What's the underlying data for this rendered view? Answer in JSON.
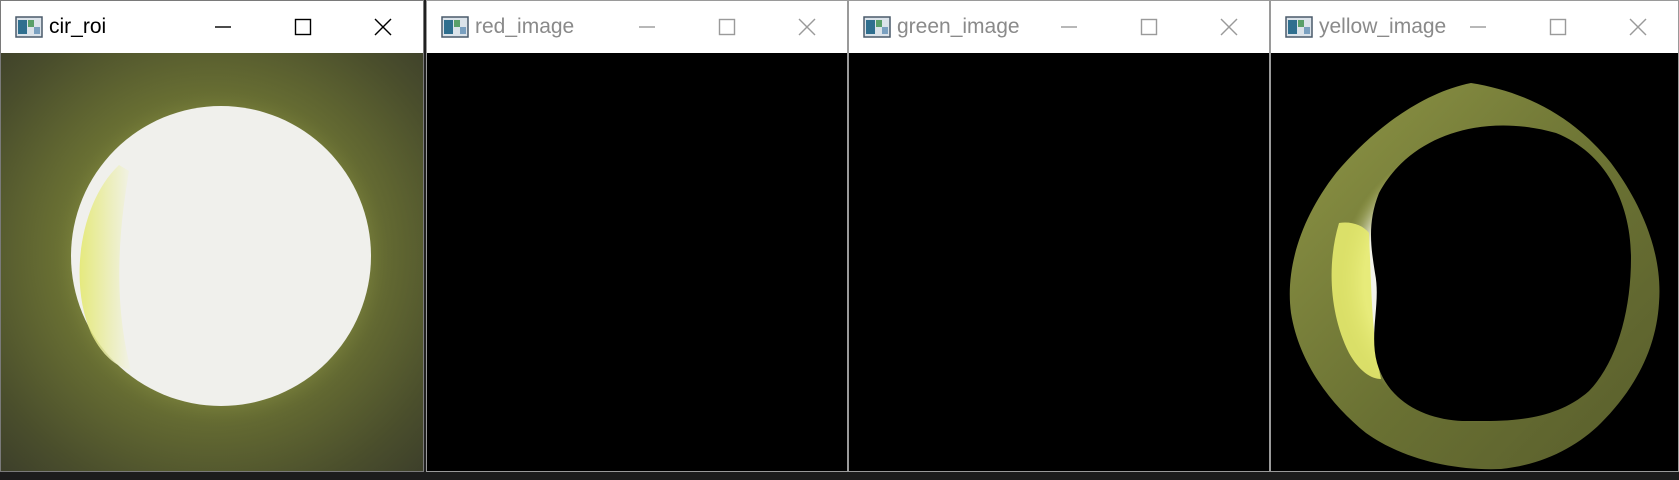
{
  "windows": [
    {
      "title": "cir_roi",
      "state": "active",
      "icon": "image-window-icon"
    },
    {
      "title": "red_image",
      "state": "inactive",
      "icon": "image-window-icon"
    },
    {
      "title": "green_image",
      "state": "inactive",
      "icon": "image-window-icon"
    },
    {
      "title": "yellow_image",
      "state": "inactive",
      "icon": "image-window-icon"
    }
  ],
  "controls": [
    "minimize-icon",
    "maximize-icon",
    "close-icon"
  ],
  "colors": {
    "active_title": "#000000",
    "inactive_title": "#8a8a8a",
    "image_background": "#000000",
    "roi_ring": "#6b7232",
    "roi_center": "#f2f2ee",
    "roi_highlight": "#e8ec78"
  }
}
